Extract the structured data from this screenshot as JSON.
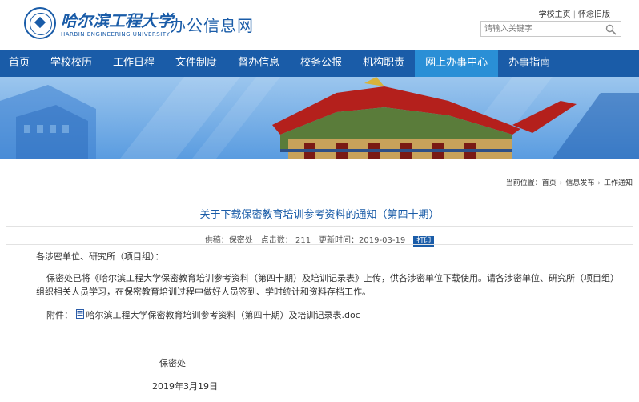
{
  "header": {
    "logo_cn": "哈尔滨工程大学",
    "logo_en": "HARBIN ENGINEERING UNIVERSITY",
    "site_title": "办公信息网",
    "toplinks": [
      "学校主页",
      "怀念旧版"
    ],
    "search_placeholder": "请输入关键字"
  },
  "nav": {
    "items": [
      "首页",
      "学校校历",
      "工作日程",
      "文件制度",
      "督办信息",
      "校务公报",
      "机构职责",
      "网上办事中心",
      "办事指南"
    ],
    "active": "网上办事中心"
  },
  "breadcrumb": {
    "label": "当前位置：",
    "items": [
      "首页",
      "信息发布",
      "工作通知"
    ]
  },
  "article": {
    "title": "关于下载保密教育培训参考资料的通知（第四十期）",
    "source": "供稿：保密处",
    "clicks": "点击数： 211",
    "updated": "更新时间：2019-03-19",
    "print": "打印",
    "greeting": "各涉密单位、研究所（项目组）：",
    "body": "保密处已将《哈尔滨工程大学保密教育培训参考资料（第四十期）及培训记录表》上传，供各涉密单位下载使用。请各涉密单位、研究所（项目组）组织相关人员学习，在保密教育培训过程中做好人员签到、学时统计和资料存档工作。",
    "attachment_label": "附件：",
    "attachment_name": "哈尔滨工程大学保密教育培训参考资料（第四十期）及培训记录表.doc",
    "signature": "保密处",
    "date": "2019年3月19日"
  },
  "colors": {
    "brand_blue": "#1a5ca8",
    "nav_active": "#2a8fd6"
  }
}
